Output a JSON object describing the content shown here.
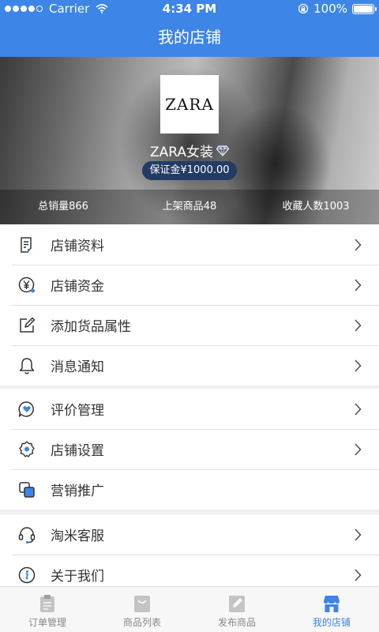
{
  "status_bar": {
    "carrier": "Carrier",
    "time": "4:34 PM",
    "battery": "100%"
  },
  "nav": {
    "title": "我的店铺"
  },
  "shop": {
    "logo_text": "ZARA",
    "name": "ZARA女装",
    "deposit": "保证金¥1000.00",
    "stats": [
      "总销量866",
      "上架商品48",
      "收藏人数1003"
    ]
  },
  "menu_groups": [
    {
      "items": [
        {
          "label": "店铺资料",
          "icon": "document-icon"
        },
        {
          "label": "店铺资金",
          "icon": "yen-icon"
        },
        {
          "label": "添加货品属性",
          "icon": "edit-icon"
        },
        {
          "label": "消息通知",
          "icon": "bell-icon"
        }
      ]
    },
    {
      "items": [
        {
          "label": "评价管理",
          "icon": "heart-chat-icon"
        },
        {
          "label": "店铺设置",
          "icon": "gear-icon"
        },
        {
          "label": "营销推广",
          "icon": "promotion-icon"
        }
      ]
    },
    {
      "items": [
        {
          "label": "淘米客服",
          "icon": "headset-icon"
        },
        {
          "label": "关于我们",
          "icon": "info-icon"
        }
      ]
    }
  ],
  "tabs": [
    {
      "label": "订单管理",
      "icon": "clipboard-icon",
      "active": false
    },
    {
      "label": "商品列表",
      "icon": "bag-icon",
      "active": false
    },
    {
      "label": "发布商品",
      "icon": "pencil-icon",
      "active": false
    },
    {
      "label": "我的店铺",
      "icon": "store-icon",
      "active": true
    }
  ],
  "colors": {
    "primary": "#3d85e6",
    "icon_dark": "#333333",
    "tab_inactive": "#c4c4c4"
  }
}
